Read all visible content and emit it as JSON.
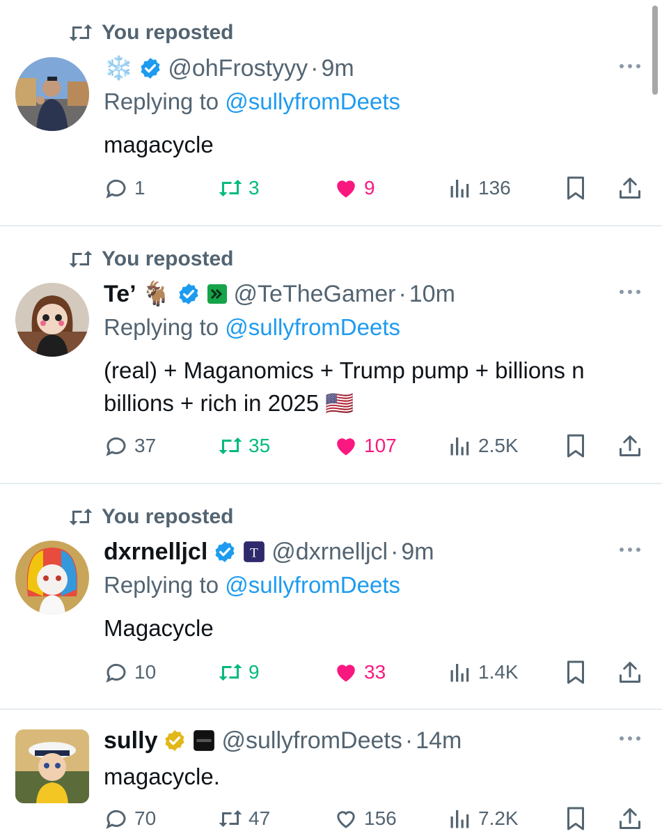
{
  "repost_label": "You reposted",
  "reply_prefix": "Replying to",
  "dot": "·",
  "colors": {
    "accent": "#1d9bf0",
    "repost_green": "#00ba7c",
    "like_pink": "#f91880",
    "muted": "#536471"
  },
  "tweets": [
    {
      "reposted": true,
      "name": "❄️",
      "badges": [
        "verified-blue-badge"
      ],
      "handle": "@ohFrostyyy",
      "time": "9m",
      "replying_to": "@sullyfromDeets",
      "text": "magacycle",
      "replies": "1",
      "reposts": "3",
      "likes": "9",
      "views": "136",
      "liked": true,
      "retweeted": true
    },
    {
      "reposted": true,
      "name": "Te’ 🐐",
      "badges": [
        "verified-blue-badge",
        "affiliate-green-badge"
      ],
      "handle": "@TeTheGamer",
      "time": "10m",
      "replying_to": "@sullyfromDeets",
      "text": "(real) + Maganomics + Trump pump + billions n billions + rich in 2025 🇺🇸",
      "replies": "37",
      "reposts": "35",
      "likes": "107",
      "views": "2.5K",
      "liked": true,
      "retweeted": true
    },
    {
      "reposted": true,
      "name": "dxrnelljcl",
      "badges": [
        "verified-blue-badge",
        "affiliate-t-badge"
      ],
      "handle": "@dxrnelljcl",
      "time": "9m",
      "replying_to": "@sullyfromDeets",
      "text": "Magacycle",
      "replies": "10",
      "reposts": "9",
      "likes": "33",
      "views": "1.4K",
      "liked": true,
      "retweeted": true
    },
    {
      "reposted": false,
      "name": "sully",
      "badges": [
        "verified-gold-badge",
        "affiliate-tradex-badge"
      ],
      "handle": "@sullyfromDeets",
      "time": "14m",
      "text": "magacycle.",
      "replies": "70",
      "reposts": "47",
      "likes": "156",
      "views": "7.2K",
      "liked": false,
      "retweeted": false
    }
  ]
}
